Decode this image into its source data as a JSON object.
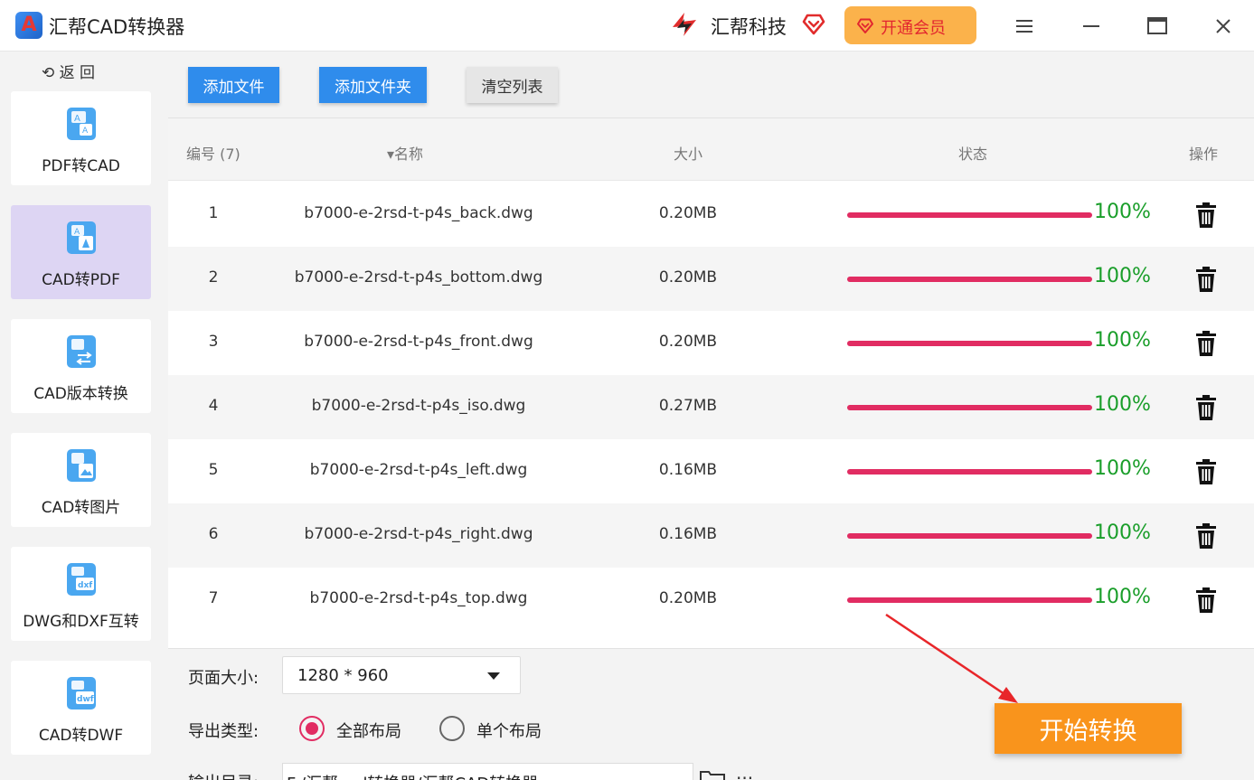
{
  "app": {
    "title": "汇帮CAD转换器",
    "brand": "汇帮科技",
    "vip_label": "开通会员"
  },
  "sidebar": {
    "back_label": "返 回",
    "items": [
      {
        "label": "PDF转CAD",
        "icon": "pdf-to-cad-icon",
        "active": false
      },
      {
        "label": "CAD转PDF",
        "icon": "cad-to-pdf-icon",
        "active": true
      },
      {
        "label": "CAD版本转换",
        "icon": "cad-version-icon",
        "active": false
      },
      {
        "label": "CAD转图片",
        "icon": "cad-to-image-icon",
        "active": false
      },
      {
        "label": "DWG和DXF互转",
        "icon": "dwg-dxf-icon",
        "active": false
      },
      {
        "label": "CAD转DWF",
        "icon": "cad-to-dwf-icon",
        "active": false
      }
    ]
  },
  "toolbar": {
    "add_file": "添加文件",
    "add_folder": "添加文件夹",
    "clear_list": "清空列表"
  },
  "table": {
    "headers": {
      "number": "编号 (7)",
      "name": "名称",
      "size": "大小",
      "status": "状态",
      "action": "操作"
    },
    "rows": [
      {
        "num": "1",
        "name": "b7000-e-2rsd-t-p4s_back.dwg",
        "size": "0.20MB",
        "progress": 100,
        "pct": "100%"
      },
      {
        "num": "2",
        "name": "b7000-e-2rsd-t-p4s_bottom.dwg",
        "size": "0.20MB",
        "progress": 100,
        "pct": "100%"
      },
      {
        "num": "3",
        "name": "b7000-e-2rsd-t-p4s_front.dwg",
        "size": "0.20MB",
        "progress": 100,
        "pct": "100%"
      },
      {
        "num": "4",
        "name": "b7000-e-2rsd-t-p4s_iso.dwg",
        "size": "0.27MB",
        "progress": 100,
        "pct": "100%"
      },
      {
        "num": "5",
        "name": "b7000-e-2rsd-t-p4s_left.dwg",
        "size": "0.16MB",
        "progress": 100,
        "pct": "100%"
      },
      {
        "num": "6",
        "name": "b7000-e-2rsd-t-p4s_right.dwg",
        "size": "0.16MB",
        "progress": 100,
        "pct": "100%"
      },
      {
        "num": "7",
        "name": "b7000-e-2rsd-t-p4s_top.dwg",
        "size": "0.20MB",
        "progress": 100,
        "pct": "100%"
      }
    ]
  },
  "settings": {
    "page_size_label": "页面大小:",
    "page_size_value": "1280 * 960",
    "export_type_label": "导出类型:",
    "export_all": "全部布局",
    "export_single": "单个布局",
    "export_selected": "all",
    "output_dir_label": "输出目录:",
    "output_dir_value": "F:/汇帮cad转换器/汇帮CAD转换器",
    "more_label": "···"
  },
  "start_button": "开始转换",
  "colors": {
    "accent_blue": "#2f8cec",
    "progress": "#e12c62",
    "percent_text": "#1a9e2a",
    "start_orange": "#f9941c",
    "vip_bg": "#fbb24b",
    "active_nav": "#ddd5f3"
  }
}
